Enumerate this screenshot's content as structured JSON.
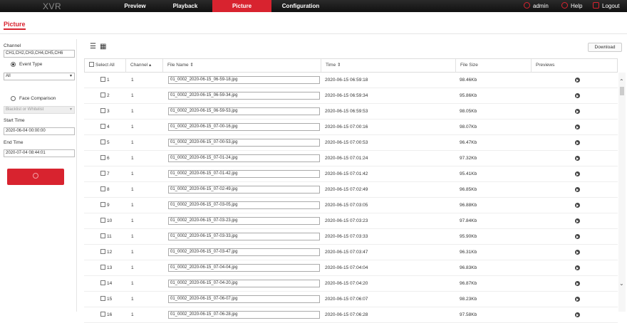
{
  "app": {
    "logo": "XVR"
  },
  "nav": {
    "tabs": [
      {
        "label": "Preview"
      },
      {
        "label": "Playback"
      },
      {
        "label": "Picture",
        "active": true
      },
      {
        "label": "Configuration"
      }
    ],
    "right": {
      "user": "admin",
      "help": "Help",
      "logout": "Logout"
    }
  },
  "page": {
    "title": "Picture"
  },
  "filters": {
    "channel_label": "Channel",
    "channel_value": "CH1,CH2,CH3,CH4,CH5,CH6",
    "event_type_label": "Event Type",
    "event_type_value": "All",
    "face_comparison_label": "Face Comparison",
    "face_list_placeholder": "Blacklist or Whitelist",
    "start_time_label": "Start Time",
    "start_time_value": "2020-06-04 00:00:00",
    "end_time_label": "End Time",
    "end_time_value": "2020-07-04 08:44:01"
  },
  "toolbar": {
    "download_label": "Download"
  },
  "table": {
    "headers": {
      "select_all": "Select All",
      "channel": "Channel ▴",
      "file_name": "File Name ⇕",
      "time": "Time ⇕",
      "file_size": "File Size",
      "previews": "Previews"
    },
    "rows": [
      {
        "index": "1",
        "channel": "1",
        "file_name": "01_0002_2020-06-15_06-59-18.jpg",
        "time": "2020-06-15 06:59:18",
        "size": "98.46Kb"
      },
      {
        "index": "2",
        "channel": "1",
        "file_name": "01_0002_2020-06-15_06-59-34.jpg",
        "time": "2020-06-15 06:59:34",
        "size": "95.86Kb"
      },
      {
        "index": "3",
        "channel": "1",
        "file_name": "01_0002_2020-06-15_06-59-53.jpg",
        "time": "2020-06-15 06:59:53",
        "size": "98.05Kb"
      },
      {
        "index": "4",
        "channel": "1",
        "file_name": "01_0002_2020-06-15_07-00-16.jpg",
        "time": "2020-06-15 07:00:16",
        "size": "98.07Kb"
      },
      {
        "index": "5",
        "channel": "1",
        "file_name": "01_0002_2020-06-15_07-00-53.jpg",
        "time": "2020-06-15 07:00:53",
        "size": "96.47Kb"
      },
      {
        "index": "6",
        "channel": "1",
        "file_name": "01_0002_2020-06-15_07-01-24.jpg",
        "time": "2020-06-15 07:01:24",
        "size": "97.32Kb"
      },
      {
        "index": "7",
        "channel": "1",
        "file_name": "01_0002_2020-06-15_07-01-42.jpg",
        "time": "2020-06-15 07:01:42",
        "size": "95.41Kb"
      },
      {
        "index": "8",
        "channel": "1",
        "file_name": "01_0002_2020-06-15_07-02-49.jpg",
        "time": "2020-06-15 07:02:49",
        "size": "96.85Kb"
      },
      {
        "index": "9",
        "channel": "1",
        "file_name": "01_0002_2020-06-15_07-03-05.jpg",
        "time": "2020-06-15 07:03:05",
        "size": "96.88Kb"
      },
      {
        "index": "10",
        "channel": "1",
        "file_name": "01_0002_2020-06-15_07-03-23.jpg",
        "time": "2020-06-15 07:03:23",
        "size": "97.84Kb"
      },
      {
        "index": "11",
        "channel": "1",
        "file_name": "01_0002_2020-06-15_07-03-33.jpg",
        "time": "2020-06-15 07:03:33",
        "size": "95.90Kb"
      },
      {
        "index": "12",
        "channel": "1",
        "file_name": "01_0002_2020-06-15_07-03-47.jpg",
        "time": "2020-06-15 07:03:47",
        "size": "96.31Kb"
      },
      {
        "index": "13",
        "channel": "1",
        "file_name": "01_0002_2020-06-15_07-04-04.jpg",
        "time": "2020-06-15 07:04:04",
        "size": "96.83Kb"
      },
      {
        "index": "14",
        "channel": "1",
        "file_name": "01_0002_2020-06-15_07-04-20.jpg",
        "time": "2020-06-15 07:04:20",
        "size": "96.87Kb"
      },
      {
        "index": "15",
        "channel": "1",
        "file_name": "01_0002_2020-06-15_07-06-07.jpg",
        "time": "2020-06-15 07:06:07",
        "size": "98.23Kb"
      },
      {
        "index": "16",
        "channel": "1",
        "file_name": "01_0002_2020-06-15_07-06-28.jpg",
        "time": "2020-06-15 07:06:28",
        "size": "97.58Kb"
      }
    ]
  },
  "colors": {
    "accent": "#d8232f",
    "topbar": "#1a1a1a"
  }
}
